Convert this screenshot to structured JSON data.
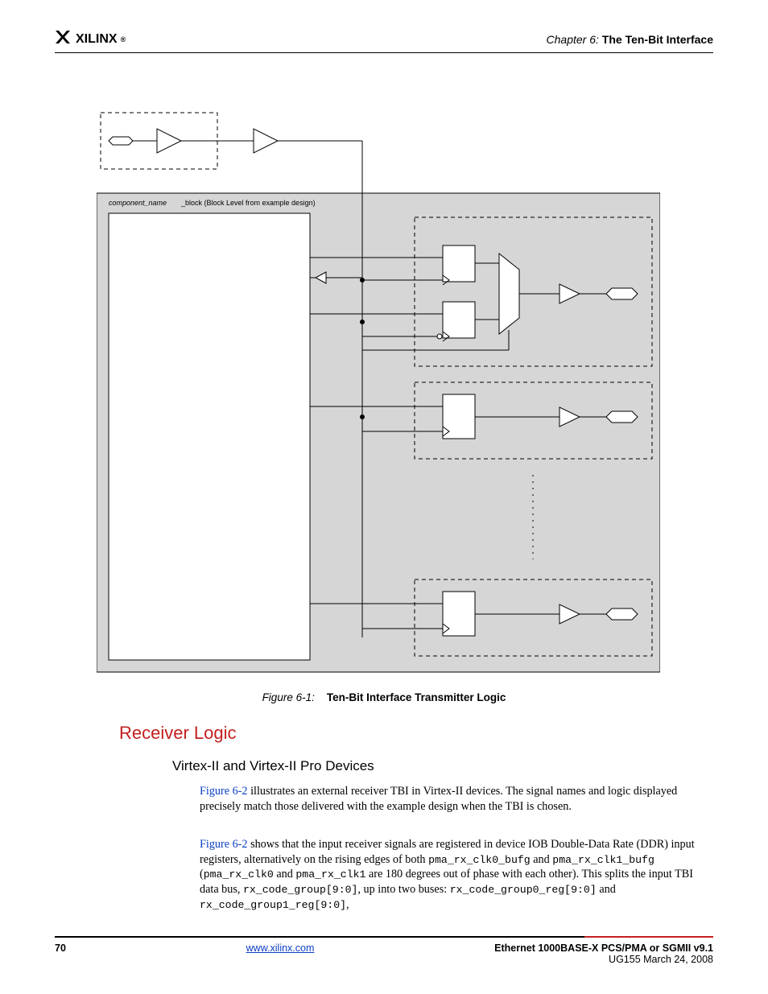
{
  "header": {
    "logo_text": "XILINX",
    "logo_reg": "®",
    "chapter_num": "Chapter 6:",
    "chapter_title": "The Ten-Bit Interface"
  },
  "figure": {
    "block_label": "component_name_block (Block Level from example design)",
    "caption_num": "Figure 6-1:",
    "caption_title": "Ten-Bit Interface Transmitter Logic"
  },
  "headings": {
    "h2": "Receiver Logic",
    "h3": "Virtex-II and Virtex-II Pro Devices"
  },
  "para1": {
    "link1": "Figure 6-2",
    "text1": " illustrates an external receiver TBI in Virtex-II devices. The signal names and logic displayed precisely match those delivered with the example design when the TBI is chosen."
  },
  "para2": {
    "link1": "Figure 6-2",
    "text1": " shows that the input receiver signals are registered in device IOB Double-Data Rate (DDR) input registers, alternatively on the rising edges of both ",
    "mono1": "pma_rx_clk0_bufg",
    "text2": " and ",
    "mono2": "pma_rx_clk1_bufg",
    "text3": " (",
    "mono3": "pma_rx_clk0",
    "text4": " and ",
    "mono4": "pma_rx_clk1",
    "text5": " are 180 degrees out of phase with each other). This splits the input TBI data bus, ",
    "mono5": "rx_code_group[9:0]",
    "text6": ", up into two buses: ",
    "mono6": "rx_code_group0_reg[9:0]",
    "text7": " and ",
    "mono7": "rx_code_group1_reg[9:0]",
    "text8": ","
  },
  "footer": {
    "page": "70",
    "url": "www.xilinx.com",
    "doc_title": "Ethernet 1000BASE-X PCS/PMA or SGMII v9.1",
    "doc_ref": "UG155 March 24, 2008"
  }
}
